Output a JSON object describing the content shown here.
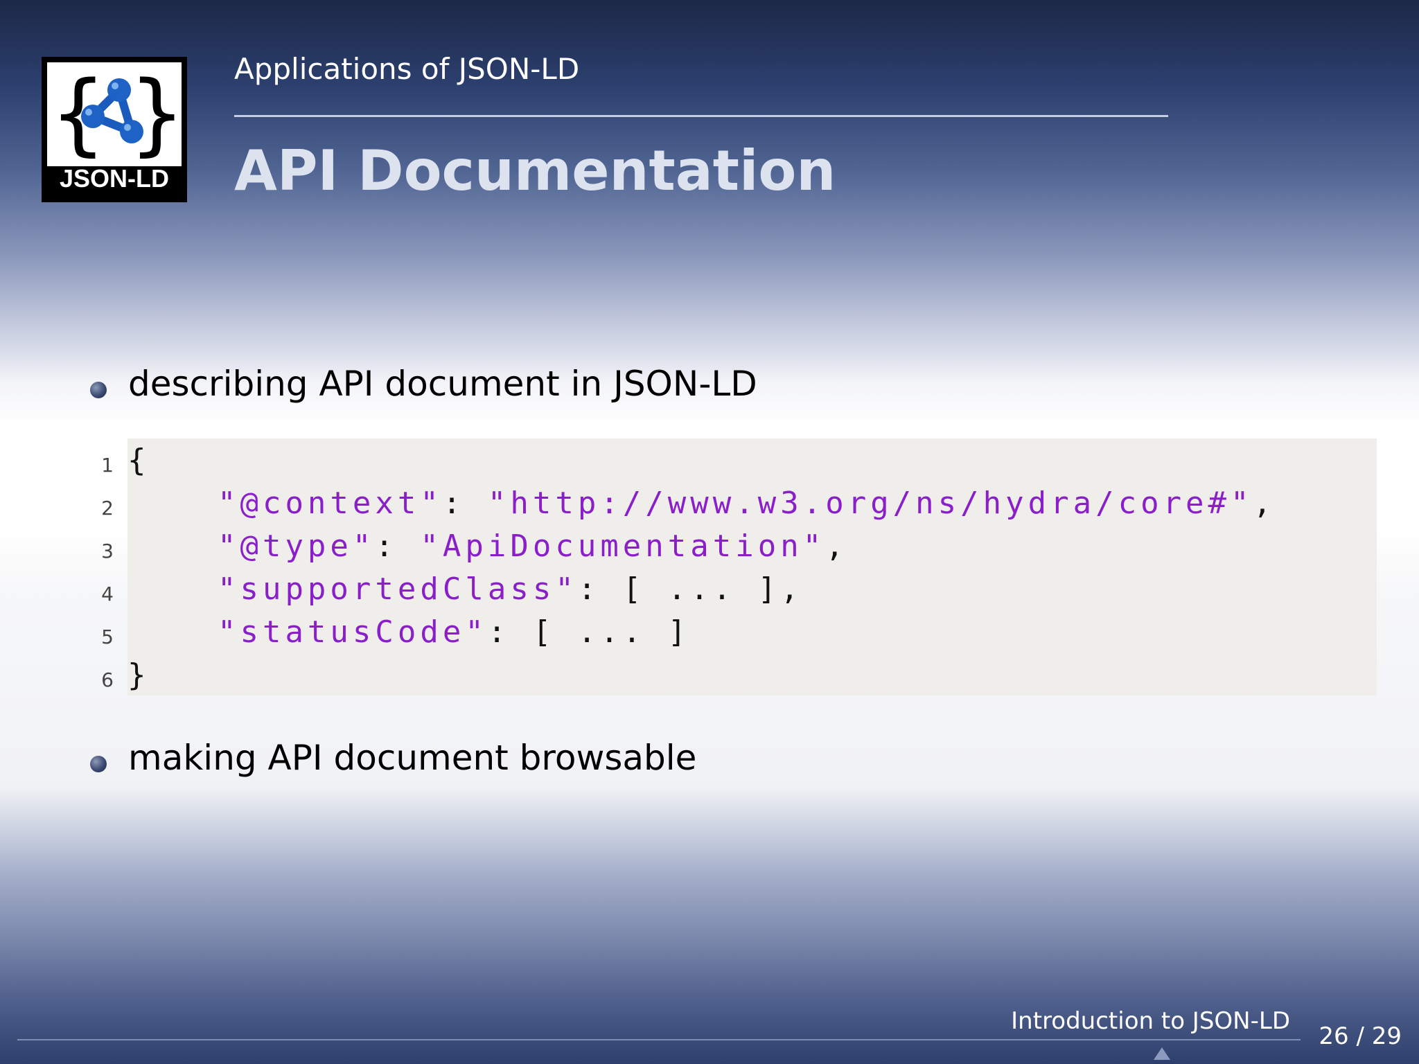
{
  "logo": {
    "text": "JSON-LD"
  },
  "header": {
    "section": "Applications of JSON-LD",
    "title": "API Documentation"
  },
  "bullets": [
    "describing API document in JSON-LD",
    "making API document browsable"
  ],
  "code": {
    "line_numbers": [
      "1",
      "2",
      "3",
      "4",
      "5",
      "6"
    ],
    "lines": [
      [
        "{"
      ],
      [
        "    ",
        "\"@context\"",
        ": ",
        "\"http://www.w3.org/ns/hydra/core#\"",
        ","
      ],
      [
        "    ",
        "\"@type\"",
        ": ",
        "\"ApiDocumentation\"",
        ","
      ],
      [
        "    ",
        "\"supportedClass\"",
        ": [ ... ],"
      ],
      [
        "    ",
        "\"statusCode\"",
        ": [ ... ]"
      ],
      [
        "}"
      ]
    ]
  },
  "footer": {
    "title": "Introduction to JSON-LD",
    "page": "26 / 29"
  },
  "colors": {
    "string": "#8a1fc9",
    "code_bg": "#efeeeb",
    "title": "#dde2ef"
  }
}
